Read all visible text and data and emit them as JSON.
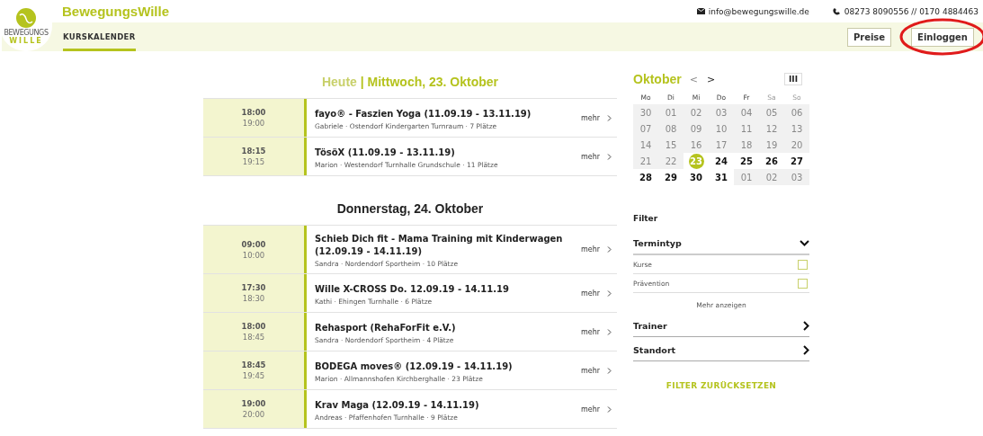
{
  "brand": {
    "name": "BewegungsWille",
    "logo_text_top": "BEWEGUNGS",
    "logo_text_bottom": "WILLE"
  },
  "contact": {
    "email": "info@bewegungswille.de",
    "phone": "08273 8090556 // 0170 4884463"
  },
  "nav": {
    "tabs": [
      {
        "label": "KURSKALENDER",
        "selected": true
      }
    ],
    "buttons": [
      {
        "label": "Preise",
        "highlighted": false
      },
      {
        "label": "Einloggen",
        "highlighted": true
      }
    ]
  },
  "days": [
    {
      "prefix": "Heute",
      "separator": "|",
      "title": "Mittwoch, 23. Oktober",
      "today": true,
      "events": [
        {
          "start": "18:00",
          "end": "19:00",
          "title": "fayo® - Faszien Yoga (11.09.19 - 13.11.19)",
          "details": "Gabriele · Ostendorf Kindergarten Turnraum · 7 Plätze",
          "more": "mehr"
        },
        {
          "start": "18:15",
          "end": "19:15",
          "title": "TösöX (11.09.19 - 13.11.19)",
          "details": "Marion · Westendorf Turnhalle Grundschule  · 11 Plätze",
          "more": "mehr"
        }
      ]
    },
    {
      "title": "Donnerstag, 24. Oktober",
      "today": false,
      "events": [
        {
          "start": "09:00",
          "end": "10:00",
          "title": "Schieb Dich fit - Mama Training mit Kinderwagen (12.09.19 - 14.11.19)",
          "details": "Sandra · Nordendorf Sportheim  · 10 Plätze",
          "more": "mehr"
        },
        {
          "start": "17:30",
          "end": "18:30",
          "title": "Wille X-CROSS Do. 12.09.19 - 14.11.19",
          "details": "Kathi · Ehingen Turnhalle  · 6 Plätze",
          "more": "mehr"
        },
        {
          "start": "18:00",
          "end": "18:45",
          "title": "Rehasport (RehaForFit e.V.)",
          "details": "Sandra · Nordendorf Sportheim  · 4 Plätze",
          "more": "mehr"
        },
        {
          "start": "18:45",
          "end": "19:45",
          "title": "BODEGA moves® (12.09.19 - 14.11.19)",
          "details": "Marion · Allmannshofen Kirchberghalle · 23 Plätze",
          "more": "mehr"
        },
        {
          "start": "19:00",
          "end": "20:00",
          "title": "Krav Maga (12.09.19 - 14.11.19)",
          "details": "Andreas · Pfaffenhofen Turnhalle · 9 Plätze",
          "more": "mehr"
        }
      ]
    }
  ],
  "calendar": {
    "month": "Oktober",
    "prev": "<",
    "next": ">",
    "view_toggle": "III",
    "weekdays": [
      {
        "label": "Mo",
        "weekend": false
      },
      {
        "label": "Di",
        "weekend": false
      },
      {
        "label": "Mi",
        "weekend": false
      },
      {
        "label": "Do",
        "weekend": false
      },
      {
        "label": "Fr",
        "weekend": false
      },
      {
        "label": "Sa",
        "weekend": true
      },
      {
        "label": "So",
        "weekend": true
      }
    ],
    "days": [
      {
        "label": "30",
        "active": false,
        "selected": false
      },
      {
        "label": "01",
        "active": false,
        "selected": false
      },
      {
        "label": "02",
        "active": false,
        "selected": false
      },
      {
        "label": "03",
        "active": false,
        "selected": false
      },
      {
        "label": "04",
        "active": false,
        "selected": false
      },
      {
        "label": "05",
        "active": false,
        "selected": false
      },
      {
        "label": "06",
        "active": false,
        "selected": false
      },
      {
        "label": "07",
        "active": false,
        "selected": false
      },
      {
        "label": "08",
        "active": false,
        "selected": false
      },
      {
        "label": "09",
        "active": false,
        "selected": false
      },
      {
        "label": "10",
        "active": false,
        "selected": false
      },
      {
        "label": "11",
        "active": false,
        "selected": false
      },
      {
        "label": "12",
        "active": false,
        "selected": false
      },
      {
        "label": "13",
        "active": false,
        "selected": false
      },
      {
        "label": "14",
        "active": false,
        "selected": false
      },
      {
        "label": "15",
        "active": false,
        "selected": false
      },
      {
        "label": "16",
        "active": false,
        "selected": false
      },
      {
        "label": "17",
        "active": false,
        "selected": false
      },
      {
        "label": "18",
        "active": false,
        "selected": false
      },
      {
        "label": "19",
        "active": false,
        "selected": false
      },
      {
        "label": "20",
        "active": false,
        "selected": false
      },
      {
        "label": "21",
        "active": false,
        "selected": false
      },
      {
        "label": "22",
        "active": false,
        "selected": false
      },
      {
        "label": "23",
        "active": true,
        "selected": true
      },
      {
        "label": "24",
        "active": true,
        "selected": false
      },
      {
        "label": "25",
        "active": true,
        "selected": false
      },
      {
        "label": "26",
        "active": true,
        "selected": false
      },
      {
        "label": "27",
        "active": true,
        "selected": false
      },
      {
        "label": "28",
        "active": true,
        "selected": false
      },
      {
        "label": "29",
        "active": true,
        "selected": false
      },
      {
        "label": "30",
        "active": true,
        "selected": false
      },
      {
        "label": "31",
        "active": true,
        "selected": false
      },
      {
        "label": "01",
        "active": false,
        "selected": false
      },
      {
        "label": "02",
        "active": false,
        "selected": false
      },
      {
        "label": "03",
        "active": false,
        "selected": false
      }
    ]
  },
  "filter": {
    "title": "Filter",
    "groups": [
      {
        "label": "Termintyp",
        "expanded": true,
        "options": [
          {
            "label": "Kurse",
            "checked": false
          },
          {
            "label": "Prävention",
            "checked": false
          }
        ],
        "more": "Mehr anzeigen"
      },
      {
        "label": "Trainer",
        "expanded": false
      },
      {
        "label": "Standort",
        "expanded": false
      }
    ],
    "reset": "FILTER ZURÜCKSETZEN"
  }
}
